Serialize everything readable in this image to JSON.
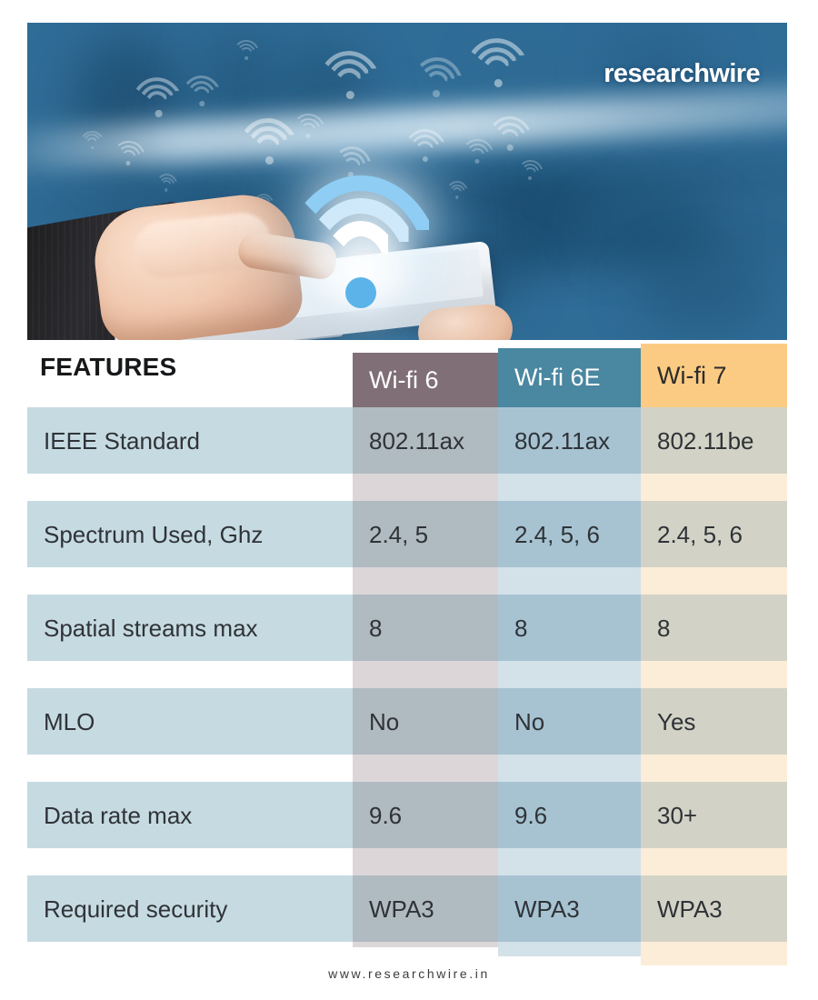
{
  "brand": {
    "logo_text": "researchwire",
    "footer_url": "www.researchwire.in"
  },
  "hero": {
    "alt": "Hand in dark suit touching a white tablet with glowing blue Wi-Fi symbol over a blurred blue office background"
  },
  "table": {
    "features_heading": "FEATURES",
    "columns": [
      {
        "label": "Wi-fi 6",
        "header_bg": "#806F76",
        "header_text": "#FFFFFF",
        "cell_bg": "#B0BAC1",
        "gap_bg": "#DCD6D9"
      },
      {
        "label": "Wi-fi 6E",
        "header_bg": "#4A87A0",
        "header_text": "#FFFFFF",
        "cell_bg": "#A7C3D2",
        "gap_bg": "#D3E1E9"
      },
      {
        "label": "Wi-fi 7",
        "header_bg": "#FCCB83",
        "header_text": "#2B2B2B",
        "cell_bg": "#D2D3C6",
        "gap_bg": "#FCEDD8"
      }
    ],
    "feature_column": {
      "cell_bg": "#C6DAE2",
      "gap_bg": "#FFFFFF",
      "text": "#2F3337"
    },
    "rows": [
      {
        "feature": "IEEE Standard",
        "values": [
          "802.11ax",
          "802.11ax",
          "802.11be"
        ]
      },
      {
        "feature": "Spectrum Used, Ghz",
        "values": [
          "2.4, 5",
          "2.4, 5, 6",
          "2.4, 5, 6"
        ]
      },
      {
        "feature": "Spatial streams max",
        "values": [
          "8",
          "8",
          "8"
        ]
      },
      {
        "feature": "MLO",
        "values": [
          "No",
          "No",
          "Yes"
        ]
      },
      {
        "feature": "Data rate max",
        "values": [
          "9.6",
          "9.6",
          "30+"
        ]
      },
      {
        "feature": "Required security",
        "values": [
          "WPA3",
          "WPA3",
          "WPA3"
        ]
      }
    ]
  }
}
